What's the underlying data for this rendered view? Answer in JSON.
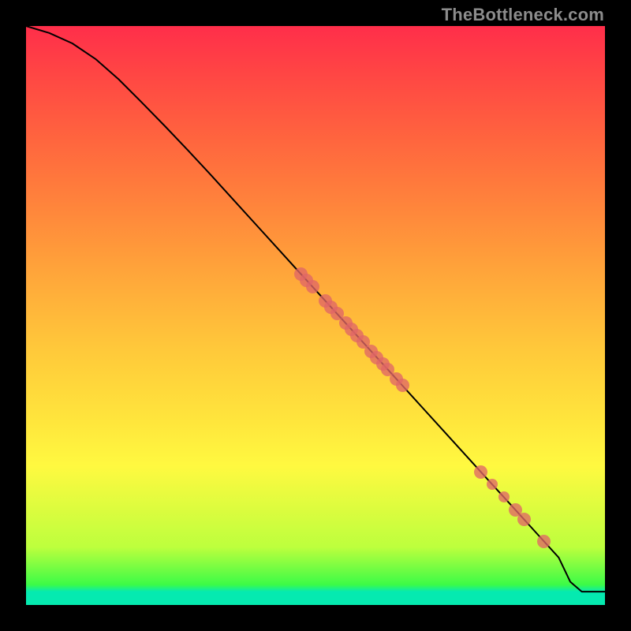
{
  "watermark": "TheBottleneck.com",
  "colors": {
    "dot": "#e06666",
    "line": "#000000"
  },
  "chart_data": {
    "type": "line",
    "title": "",
    "xlabel": "",
    "ylabel": "",
    "xlim": [
      0,
      100
    ],
    "ylim": [
      0,
      100
    ],
    "grid": false,
    "series": [
      {
        "name": "curve",
        "x": [
          0,
          4,
          8,
          12,
          16,
          20,
          24,
          28,
          32,
          36,
          40,
          44,
          48,
          52,
          56,
          60,
          64,
          68,
          72,
          76,
          80,
          84,
          88,
          92,
          94,
          96,
          100
        ],
        "y": [
          100,
          98.8,
          97.0,
          94.3,
          90.8,
          86.8,
          82.7,
          78.5,
          74.2,
          69.8,
          65.4,
          61.0,
          56.6,
          52.2,
          47.8,
          43.4,
          39.0,
          34.6,
          30.2,
          25.8,
          21.4,
          17.0,
          12.6,
          8.2,
          4.0,
          2.3,
          2.3
        ]
      }
    ],
    "points": [
      {
        "x": 47.5,
        "y": 57.1,
        "size": "big"
      },
      {
        "x": 48.5,
        "y": 56.0,
        "size": "big"
      },
      {
        "x": 49.5,
        "y": 55.0,
        "size": "big"
      },
      {
        "x": 51.7,
        "y": 52.5,
        "size": "big"
      },
      {
        "x": 52.7,
        "y": 51.4,
        "size": "big"
      },
      {
        "x": 53.7,
        "y": 50.3,
        "size": "big"
      },
      {
        "x": 55.2,
        "y": 48.7,
        "size": "big"
      },
      {
        "x": 56.2,
        "y": 47.6,
        "size": "big"
      },
      {
        "x": 57.2,
        "y": 46.5,
        "size": "big"
      },
      {
        "x": 58.2,
        "y": 45.4,
        "size": "big"
      },
      {
        "x": 59.6,
        "y": 43.8,
        "size": "big"
      },
      {
        "x": 60.6,
        "y": 42.7,
        "size": "big"
      },
      {
        "x": 61.6,
        "y": 41.6,
        "size": "big"
      },
      {
        "x": 62.5,
        "y": 40.6,
        "size": "big"
      },
      {
        "x": 64.0,
        "y": 39.0,
        "size": "big"
      },
      {
        "x": 65.0,
        "y": 37.9,
        "size": "big"
      },
      {
        "x": 78.5,
        "y": 23.0,
        "size": "big"
      },
      {
        "x": 80.5,
        "y": 20.8,
        "size": "normal"
      },
      {
        "x": 82.5,
        "y": 18.6,
        "size": "normal"
      },
      {
        "x": 84.5,
        "y": 16.4,
        "size": "big"
      },
      {
        "x": 86.0,
        "y": 14.8,
        "size": "big"
      },
      {
        "x": 89.5,
        "y": 11.0,
        "size": "big"
      }
    ]
  }
}
